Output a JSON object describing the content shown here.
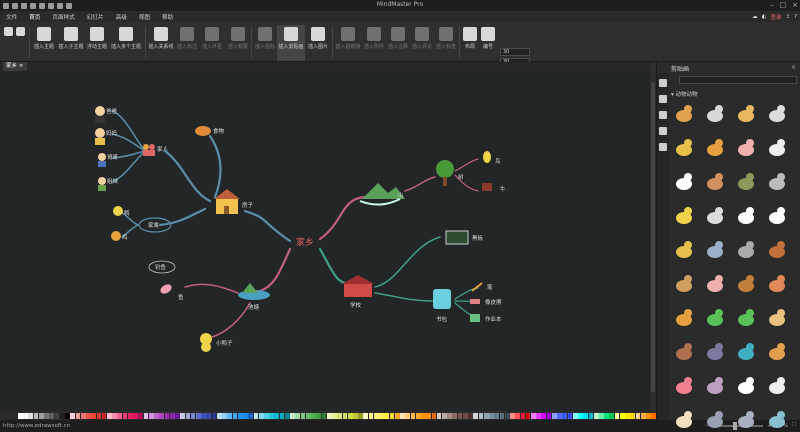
{
  "app": {
    "title": "MindMaster Pro"
  },
  "menu": [
    "文件",
    "首页",
    "页面样式",
    "幻灯片",
    "高级",
    "视图",
    "帮助"
  ],
  "topright": {
    "login": "登录",
    "help": "?"
  },
  "ribbon": {
    "buttons": [
      {
        "label": "插入主题",
        "icon": "topic-icon"
      },
      {
        "label": "插入子主题",
        "icon": "subtopic-icon"
      },
      {
        "label": "浮动主题",
        "icon": "floating-topic-icon"
      },
      {
        "label": "插入多个主题",
        "icon": "multi-topic-icon"
      },
      {
        "label": "插入关系线",
        "icon": "relation-icon"
      },
      {
        "label": "插入标注",
        "icon": "callout-icon"
      },
      {
        "label": "插入外框",
        "icon": "boundary-icon"
      },
      {
        "label": "插入概要",
        "icon": "summary-icon"
      },
      {
        "label": "插入图标",
        "icon": "insert-icon-icon"
      },
      {
        "label": "插入剪贴画",
        "icon": "clipart-icon"
      },
      {
        "label": "插入图片",
        "icon": "picture-icon"
      },
      {
        "label": "插入超链接",
        "icon": "link-icon"
      },
      {
        "label": "插入附件",
        "icon": "attachment-icon"
      },
      {
        "label": "插入注释",
        "icon": "note-icon"
      },
      {
        "label": "插入评论",
        "icon": "comment-icon"
      },
      {
        "label": "插入标签",
        "icon": "tag-icon"
      },
      {
        "label": "布局",
        "icon": "layout-icon"
      },
      {
        "label": "编号",
        "icon": "numbering-icon"
      }
    ],
    "spin1": "30",
    "spin2": "30",
    "reset": "重置"
  },
  "tab": {
    "title": "家乡"
  },
  "mindmap": {
    "center": "家乡",
    "house": "房子",
    "family": "家人",
    "members": [
      "爸爸",
      "妈妈",
      "哥哥",
      "姐妹"
    ],
    "food": "食物",
    "poultry": "家禽",
    "poultry_items": [
      "鸭",
      "鸡"
    ],
    "mountain": "山",
    "tree": "树",
    "bird": "鸟",
    "cow": "牛",
    "pond": "池塘",
    "fish": "鱼",
    "fishing": "钓鱼",
    "duckling": "小鸭子",
    "school": "学校",
    "blackboard": "黑板",
    "schoolbag": "书包",
    "pen": "笔",
    "eraser": "橡皮擦",
    "homework": "作业本"
  },
  "rightpanel": {
    "title": "剪贴画",
    "close": "×",
    "category": "动物动物",
    "animals": [
      "dog",
      "rabbit",
      "cat",
      "bird",
      "giraffe",
      "dog2",
      "pig",
      "sheep",
      "cow",
      "squirrel",
      "turtle",
      "mouse",
      "duck",
      "dove",
      "dove2",
      "panda",
      "snake",
      "elephant",
      "koala",
      "horse",
      "camel",
      "pig2",
      "deer",
      "snail",
      "lizard",
      "frog",
      "frog2",
      "seahorse",
      "rhino",
      "bat",
      "lizard2",
      "leopard",
      "pig3",
      "hippo",
      "polar-bear",
      "bears",
      "bear",
      "elephant2",
      "elephant3",
      "crocodile"
    ]
  },
  "palette": [
    "#ffffff",
    "#f5f5f5",
    "#e0e0e0",
    "#bdbdbd",
    "#9e9e9e",
    "#757575",
    "#616161",
    "#424242",
    "#212121",
    "#000000",
    "#ffcdd2",
    "#ef9a9a",
    "#e57373",
    "#ef5350",
    "#f44336",
    "#e53935",
    "#c62828",
    "#f8bbd0",
    "#f48fb1",
    "#f06292",
    "#ec407a",
    "#e91e63",
    "#d81b60",
    "#ad1457",
    "#e1bee7",
    "#ce93d8",
    "#ba68c8",
    "#ab47bc",
    "#9c27b0",
    "#8e24aa",
    "#6a1b9a",
    "#c5cae9",
    "#9fa8da",
    "#7986cb",
    "#5c6bc0",
    "#3f51b5",
    "#3949ab",
    "#283593",
    "#bbdefb",
    "#90caf9",
    "#64b5f6",
    "#42a5f5",
    "#2196f3",
    "#1e88e5",
    "#1565c0",
    "#b2ebf2",
    "#80deea",
    "#4dd0e1",
    "#26c6da",
    "#00bcd4",
    "#00acc1",
    "#00838f",
    "#c8e6c9",
    "#a5d6a7",
    "#81c784",
    "#66bb6a",
    "#4caf50",
    "#43a047",
    "#2e7d32",
    "#f0f4c3",
    "#e6ee9c",
    "#dce775",
    "#d4e157",
    "#cddc39",
    "#c0ca33",
    "#9e9d24",
    "#fff9c4",
    "#fff59d",
    "#fff176",
    "#ffee58",
    "#ffeb3b",
    "#fdd835",
    "#f9a825",
    "#ffe0b2",
    "#ffcc80",
    "#ffb74d",
    "#ffa726",
    "#ff9800",
    "#fb8c00",
    "#ef6c00",
    "#d7ccc8",
    "#bcaaa4",
    "#a1887f",
    "#8d6e63",
    "#795548",
    "#6d4c41",
    "#4e342e",
    "#cfd8dc",
    "#b0bec5",
    "#90a4ae",
    "#78909c",
    "#607d8b",
    "#546e7a",
    "#37474f",
    "#ff8a80",
    "#ff5252",
    "#ff1744",
    "#d50000",
    "#ea80fc",
    "#e040fb",
    "#d500f9",
    "#aa00ff",
    "#8c9eff",
    "#536dfe",
    "#3d5afe",
    "#304ffe",
    "#84ffff",
    "#18ffff",
    "#00e5ff",
    "#00b8d4",
    "#b9f6ca",
    "#69f0ae",
    "#00e676",
    "#00c853",
    "#ffff8d",
    "#ffff00",
    "#ffea00",
    "#ffd600",
    "#ffd180",
    "#ffab40",
    "#ff9100",
    "#ff6d00"
  ],
  "status": {
    "url": "http://www.edrawsoft.cn",
    "zoom": "85%"
  },
  "colors": {
    "center": "#e06060",
    "branch_blue": "#5b8fa8",
    "branch_teal": "#3fa08a",
    "branch_pink": "#c06080"
  }
}
